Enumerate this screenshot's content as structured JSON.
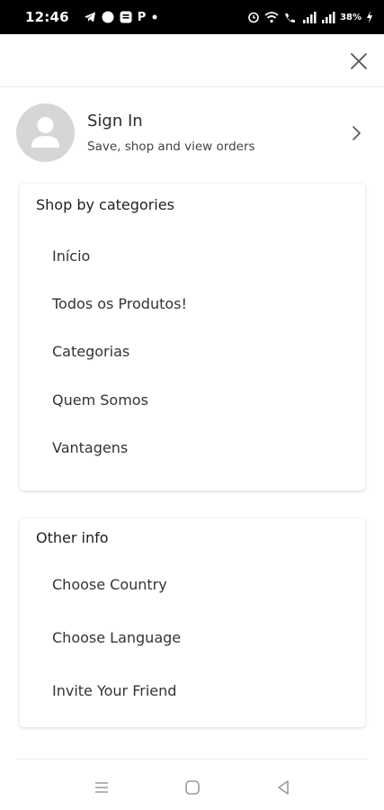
{
  "status_bar": {
    "time": "12:46",
    "left_icons": [
      "telegram-icon",
      "messenger-icon",
      "app-icon",
      "p-icon",
      "dot-icon"
    ],
    "p_label": "P",
    "battery": "38%",
    "right_icons": [
      "alarm-icon",
      "wifi-icon",
      "volte-icon",
      "signal-icon",
      "signal-icon",
      "battery-icon"
    ]
  },
  "header": {
    "close_icon": "close-icon"
  },
  "signin": {
    "title": "Sign In",
    "subtitle": "Save, shop and view orders",
    "avatar_icon": "person-icon",
    "chevron_icon": "chevron-right-icon"
  },
  "categories": {
    "title": "Shop by categories",
    "items": [
      "Início",
      "Todos os Produtos!",
      "Categorias",
      "Quem Somos",
      "Vantagens"
    ]
  },
  "other_info": {
    "title": "Other info",
    "items": [
      "Choose Country",
      "Choose Language",
      "Invite Your Friend"
    ]
  },
  "navbar": {
    "icons": [
      "recents-icon",
      "home-icon",
      "back-icon"
    ]
  },
  "colors": {
    "status_bar_bg": "#000000",
    "avatar_bg": "#d6d6d6",
    "text": "#2b2b2b"
  }
}
